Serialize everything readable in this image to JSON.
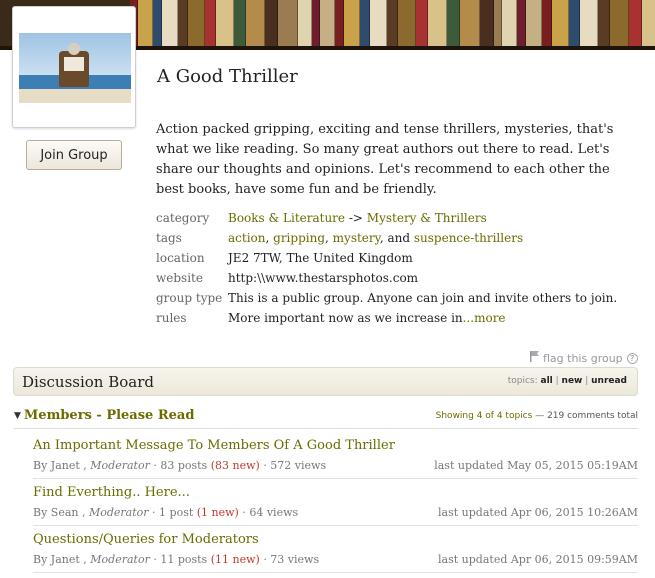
{
  "group": {
    "title": "A Good Thriller",
    "join_label": "Join Group",
    "description": "Action packed gripping, exciting and tense thrillers, mysteries, that's what we like reading. So many great authors out there to read. Let's share our thoughts and opinions. Let's recommend to each other the best books, have some fun and be friendly."
  },
  "details": {
    "category_label": "category",
    "category_parent": "Books & Literature",
    "category_sep": "->",
    "category_child": "Mystery & Thrillers",
    "tags_label": "tags",
    "tags": [
      "action",
      "gripping",
      "mystery",
      "suspence-thrillers"
    ],
    "tags_and": "and",
    "location_label": "location",
    "location": "JE2 7TW, The United Kingdom",
    "website_label": "website",
    "website": "http:\\\\www.thestarsphotos.com",
    "type_label": "group type",
    "type": "This is a public group. Anyone can join and invite others to join.",
    "rules_label": "rules",
    "rules": "More important now as we increase in",
    "rules_more": "...more"
  },
  "flag": {
    "label": "flag this group",
    "help": "?"
  },
  "board": {
    "title": "Discussion Board",
    "topics_label": "topics:",
    "filters": [
      "all",
      "new",
      "unread"
    ]
  },
  "section": {
    "title": "Members - Please Read",
    "showing": "Showing 4 of 4 topics",
    "dash": "—",
    "comments": "219 comments total"
  },
  "topics": [
    {
      "title": "An Important Message To Members Of A Good Thriller",
      "by": "By Janet ,",
      "role": "Moderator",
      "posts": "· 83 posts",
      "new": "(83 new)",
      "views": "· 572 views",
      "updated": "last updated May 05, 2015 05:19AM"
    },
    {
      "title": "Find Everthing.. Here...",
      "by": "By Sean ,",
      "role": "Moderator",
      "posts": "· 1 post",
      "new": "(1 new)",
      "views": "· 64 views",
      "updated": "last updated Apr 06, 2015 10:26AM"
    },
    {
      "title": "Questions/Queries for Moderators",
      "by": "By Janet ,",
      "role": "Moderator",
      "posts": "· 11 posts",
      "new": "(11 new)",
      "views": "· 73 views",
      "updated": "last updated Apr 06, 2015 09:59AM"
    }
  ],
  "colors": {
    "link": "#6b6b00",
    "new_count": "#c0392b",
    "muted": "#777777"
  }
}
